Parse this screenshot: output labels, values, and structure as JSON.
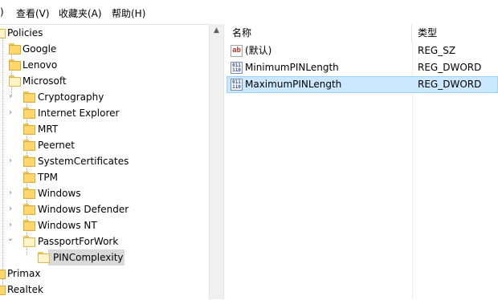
{
  "menu": {
    "partial": ")",
    "view": "查看(V)",
    "favorites": "收藏夹(A)",
    "help": "帮助(H)"
  },
  "tree": {
    "scroll_up": "▲",
    "items": [
      {
        "label": "Policies",
        "icon": "folder-open-icon",
        "expand": ""
      },
      {
        "label": "Google",
        "icon": "folder-icon",
        "expand": ""
      },
      {
        "label": "Lenovo",
        "icon": "folder-icon",
        "expand": ""
      },
      {
        "label": "Microsoft",
        "icon": "folder-open-icon",
        "expand": ""
      },
      {
        "label": "Cryptography",
        "icon": "folder-icon",
        "expand": "›"
      },
      {
        "label": "Internet Explorer",
        "icon": "folder-icon",
        "expand": "›"
      },
      {
        "label": "MRT",
        "icon": "folder-icon",
        "expand": ""
      },
      {
        "label": "Peernet",
        "icon": "folder-icon",
        "expand": ""
      },
      {
        "label": "SystemCertificates",
        "icon": "folder-icon",
        "expand": "›"
      },
      {
        "label": "TPM",
        "icon": "folder-icon",
        "expand": ""
      },
      {
        "label": "Windows",
        "icon": "folder-icon",
        "expand": "›"
      },
      {
        "label": "Windows Defender",
        "icon": "folder-icon",
        "expand": "›"
      },
      {
        "label": "Windows NT",
        "icon": "folder-icon",
        "expand": "›"
      },
      {
        "label": "PassportForWork",
        "icon": "folder-open-icon",
        "expand": "⌄"
      },
      {
        "label": "PINComplexity",
        "icon": "folder-open-icon",
        "expand": "",
        "selected": true
      },
      {
        "label": "Primax",
        "icon": "folder-icon",
        "expand": ""
      },
      {
        "label": "Realtek",
        "icon": "folder-icon",
        "expand": ""
      }
    ]
  },
  "list": {
    "headers": {
      "name": "名称",
      "type": "类型"
    },
    "rows": [
      {
        "icon": "string-value-icon",
        "icon_text": "ab",
        "name": "(默认)",
        "type": "REG_SZ",
        "selected": false
      },
      {
        "icon": "binary-value-icon",
        "icon_text": "011 110",
        "name": "MinimumPINLength",
        "type": "REG_DWORD",
        "selected": false
      },
      {
        "icon": "binary-value-icon",
        "icon_text": "011 110",
        "name": "MaximumPINLength",
        "type": "REG_DWORD",
        "selected": true
      }
    ]
  }
}
